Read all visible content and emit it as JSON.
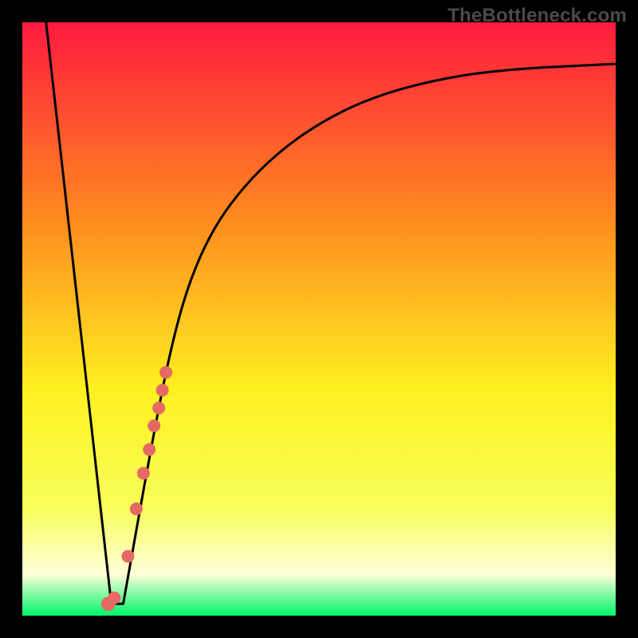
{
  "watermark": "TheBottleneck.com",
  "colors": {
    "frame": "#000000",
    "gradient_top": "#ff1a3f",
    "gradient_upper_mid": "#ff8a1f",
    "gradient_mid": "#fff020",
    "gradient_lower_mid": "#f7ff5a",
    "gradient_pale": "#ffffd8",
    "gradient_bottom": "#00f56a",
    "curve": "#000000",
    "marker": "#e46a63"
  },
  "chart_data": {
    "type": "line",
    "title": "",
    "xlabel": "",
    "ylabel": "",
    "xlim": [
      0,
      100
    ],
    "ylim": [
      0,
      100
    ],
    "series": [
      {
        "name": "bottleneck-curve",
        "x": [
          4,
          15,
          17,
          22,
          25,
          28,
          32,
          37,
          43,
          50,
          58,
          68,
          80,
          100
        ],
        "y": [
          100,
          2,
          2,
          30,
          45,
          56,
          65,
          72,
          78,
          83,
          87,
          90,
          92,
          93
        ]
      }
    ],
    "markers": {
      "name": "highlight-band",
      "x": [
        14.5,
        15.5,
        17.8,
        19.2,
        20.4,
        21.4,
        22.2,
        23.0,
        23.6,
        24.2
      ],
      "y": [
        2,
        3,
        10,
        18,
        24,
        28,
        32,
        35,
        38,
        41
      ]
    }
  }
}
